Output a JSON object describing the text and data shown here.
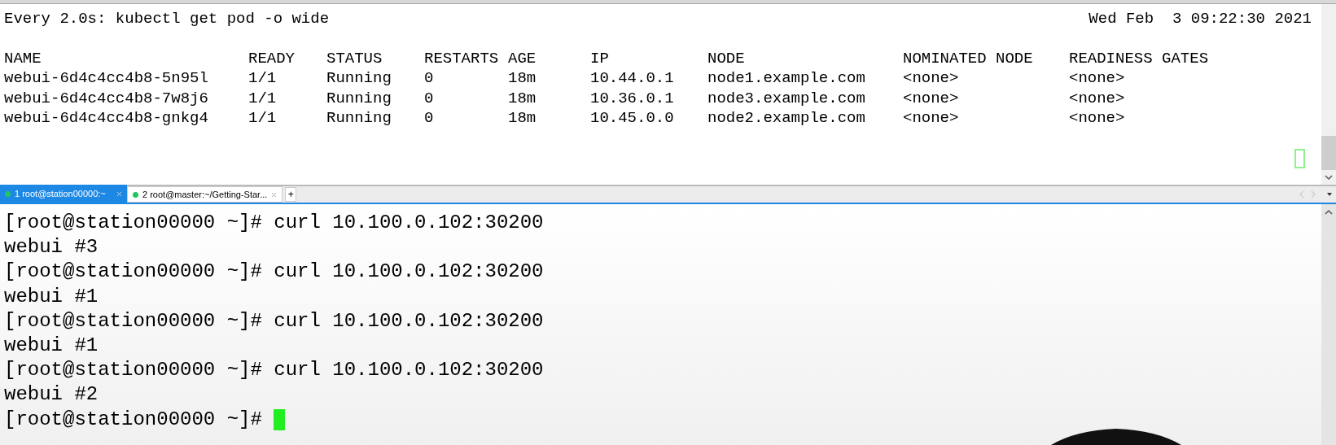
{
  "watch_pane": {
    "header": "Every 2.0s: kubectl get pod -o wide",
    "timestamp": "Wed Feb  3 09:22:30 2021",
    "columns": [
      "NAME",
      "READY",
      "STATUS",
      "RESTARTS",
      "AGE",
      "IP",
      "NODE",
      "NOMINATED NODE",
      "READINESS GATES"
    ],
    "rows": [
      [
        "webui-6d4c4cc4b8-5n95l",
        "1/1",
        "Running",
        "0",
        "18m",
        "10.44.0.1",
        "node1.example.com",
        "<none>",
        "<none>"
      ],
      [
        "webui-6d4c4cc4b8-7w8j6",
        "1/1",
        "Running",
        "0",
        "18m",
        "10.36.0.1",
        "node3.example.com",
        "<none>",
        "<none>"
      ],
      [
        "webui-6d4c4cc4b8-gnkg4",
        "1/1",
        "Running",
        "0",
        "18m",
        "10.45.0.0",
        "node2.example.com",
        "<none>",
        "<none>"
      ]
    ]
  },
  "tabs": [
    {
      "number": "1",
      "label": "root@station00000:~",
      "selected": true,
      "color": "#22c55e"
    },
    {
      "number": "2",
      "label": "root@master:~/Getting-Star...",
      "selected": false,
      "color": "#22c55e"
    }
  ],
  "new_tab": "+",
  "terminal": {
    "lines": [
      "[root@station00000 ~]# curl 10.100.0.102:30200",
      "webui #3",
      "[root@station00000 ~]# curl 10.100.0.102:30200",
      "webui #1",
      "[root@station00000 ~]# curl 10.100.0.102:30200",
      "webui #1",
      "[root@station00000 ~]# curl 10.100.0.102:30200",
      "webui #2"
    ],
    "prompt": "[root@station00000 ~]#"
  }
}
